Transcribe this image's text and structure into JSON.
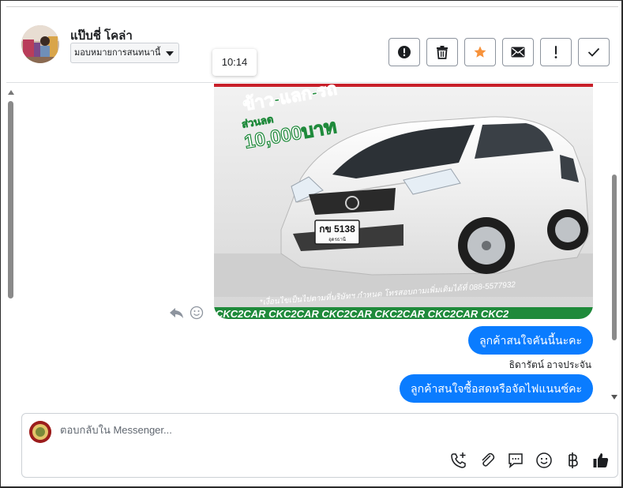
{
  "header": {
    "contact_name": "แป๊บชี่ โคล่า",
    "assign_label": "มอบหมายการสนทนานี้",
    "timestamp": "10:14",
    "toolbar": [
      {
        "name": "spam-button",
        "icon": "exclamation-circle-icon"
      },
      {
        "name": "delete-button",
        "icon": "trash-icon"
      },
      {
        "name": "star-button",
        "icon": "star-icon",
        "color": "#f7923b"
      },
      {
        "name": "mark-unread-button",
        "icon": "envelope-icon"
      },
      {
        "name": "follow-up-button",
        "icon": "exclamation-icon"
      },
      {
        "name": "mark-done-button",
        "icon": "check-icon"
      }
    ]
  },
  "conversation": {
    "photo": {
      "headline_1": "ข้าว-แลก-รถ",
      "headline_2": "ส่วนลด",
      "headline_3": "10,000บาท",
      "plate_number": "กข 5138",
      "plate_province": "อุดรธานี",
      "footer_note": "*เงื่อนไขเป็นไปตามที่บริษัทฯ กำหนด โทรสอบถามเพิ่มเติมได้ที่ 088-5577932",
      "watermark": "CKC2CAR CKC2CAR CKC2CAR CKC2CAR CKC2CAR CKC2"
    },
    "messages": [
      {
        "text": "ลูกค้าสนใจคันนี้นะคะ"
      },
      {
        "text": "ลูกค้าสนใจซื้อสดหรือจัดไฟแนนซ์คะ"
      }
    ],
    "agent_name": "ธิดารัตน์ อาจประจัน"
  },
  "composer": {
    "placeholder": "ตอบกลับใน Messenger...",
    "tools": [
      "add-call-icon",
      "paperclip-icon",
      "saved-reply-icon",
      "emoji-icon",
      "baht-icon",
      "thumbs-up-icon"
    ]
  },
  "colors": {
    "accent": "#0a7cff",
    "star": "#f7923b",
    "ad_green": "#1f8a3b"
  }
}
